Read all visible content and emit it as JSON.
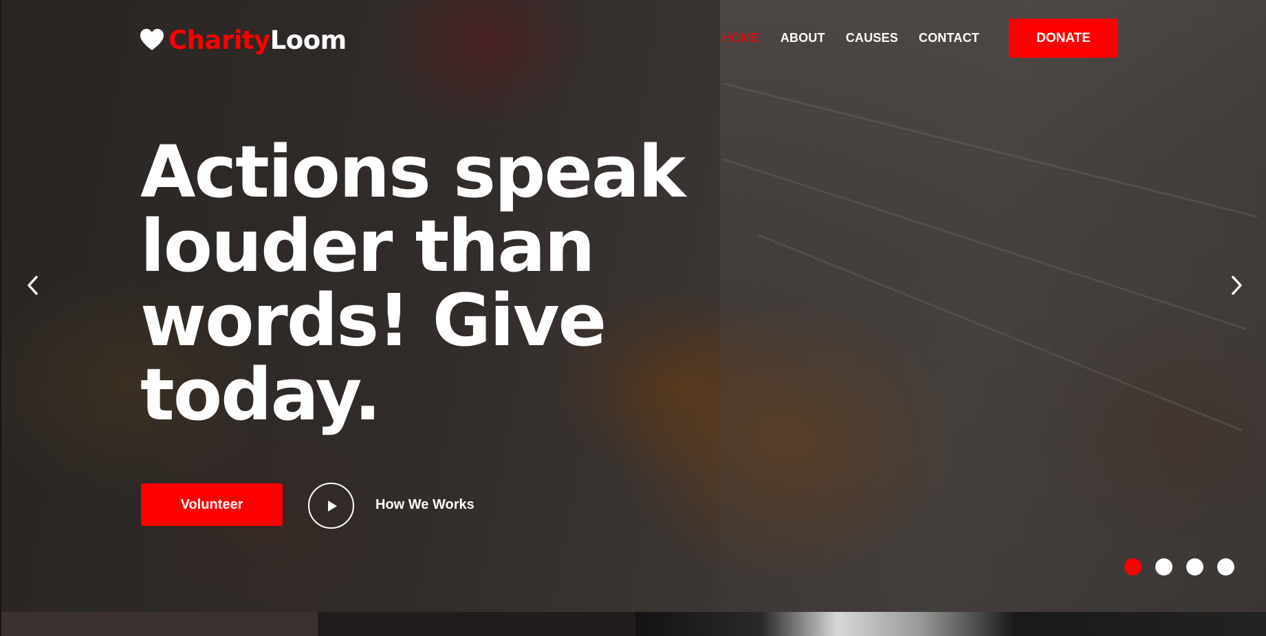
{
  "brand": {
    "name_part1": "Charity",
    "name_part2": "Loom"
  },
  "nav": {
    "items": [
      {
        "label": "HOME",
        "active": true
      },
      {
        "label": "ABOUT",
        "active": false
      },
      {
        "label": "CAUSES",
        "active": false
      },
      {
        "label": "CONTACT",
        "active": false
      }
    ],
    "donate_label": "DONATE"
  },
  "hero": {
    "headline": "Actions speak louder than words! Give today.",
    "volunteer_label": "Volunteer",
    "how_label": "How We Works"
  },
  "slider": {
    "count": 4,
    "active_index": 0
  },
  "colors": {
    "accent": "#ff0000",
    "text": "#ffffff"
  },
  "icons": [
    "heart-icon",
    "play-icon",
    "chevron-left-icon",
    "chevron-right-icon"
  ]
}
